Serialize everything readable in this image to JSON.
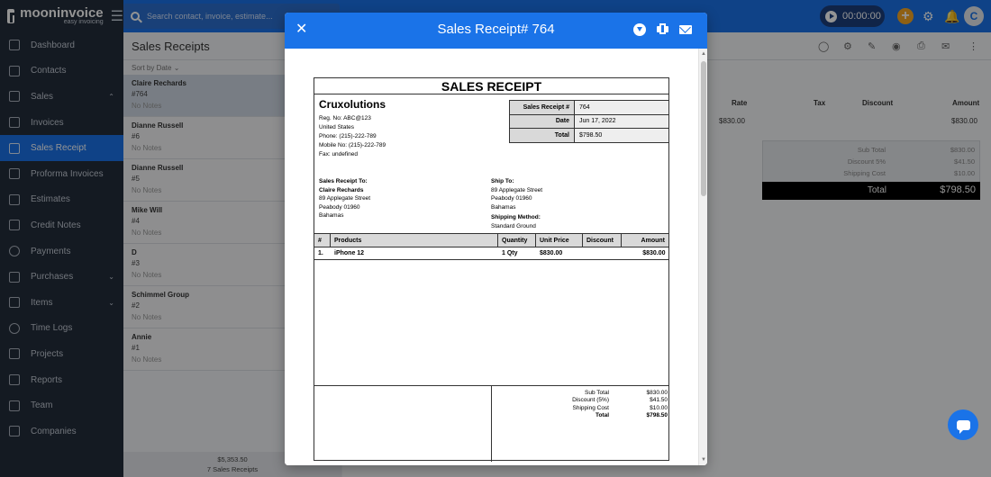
{
  "app": {
    "brand": "mooninvoice",
    "tagline": "easy invoicing",
    "search_placeholder": "Search contact, invoice, estimate...",
    "timer": "00:00:00",
    "avatar_letter": "C",
    "accent": "#1a73e8"
  },
  "sidebar": {
    "items": [
      {
        "label": "Dashboard",
        "icon": "home-icon"
      },
      {
        "label": "Contacts",
        "icon": "contacts-icon"
      },
      {
        "label": "Sales",
        "icon": "dollar-doc-icon",
        "chevron": "^"
      },
      {
        "label": "Invoices",
        "icon": "invoice-icon"
      },
      {
        "label": "Sales Receipt",
        "icon": "receipt-icon"
      },
      {
        "label": "Proforma Invoices",
        "icon": "proforma-icon"
      },
      {
        "label": "Estimates",
        "icon": "estimate-icon"
      },
      {
        "label": "Credit Notes",
        "icon": "credit-note-icon"
      },
      {
        "label": "Payments",
        "icon": "payment-icon"
      },
      {
        "label": "Purchases",
        "icon": "purchase-icon",
        "chevron": "v"
      },
      {
        "label": "Items",
        "icon": "items-icon",
        "chevron": "v"
      },
      {
        "label": "Time Logs",
        "icon": "clock-icon"
      },
      {
        "label": "Projects",
        "icon": "folder-icon"
      },
      {
        "label": "Reports",
        "icon": "report-icon"
      },
      {
        "label": "Team",
        "icon": "team-icon"
      },
      {
        "label": "Companies",
        "icon": "building-icon"
      }
    ]
  },
  "list": {
    "title": "Sales Receipts",
    "sort": "Sort by Date",
    "receipts": [
      {
        "name": "Claire Rechards",
        "number": "#764",
        "notes": "No Notes"
      },
      {
        "name": "Dianne Russell",
        "number": "#6",
        "notes": "No Notes"
      },
      {
        "name": "Dianne Russell",
        "number": "#5",
        "notes": "No Notes"
      },
      {
        "name": "Mike Will",
        "number": "#4",
        "notes": "No Notes"
      },
      {
        "name": "D",
        "number": "#3",
        "notes": "No Notes"
      },
      {
        "name": "Schimmel Group",
        "number": "#2",
        "notes": "No Notes"
      },
      {
        "name": "Annie",
        "number": "#1",
        "notes": "No Notes"
      }
    ],
    "footer_total": "$5,353.50",
    "footer_count": "7 Sales Receipts"
  },
  "detail": {
    "columns": [
      "Rate",
      "Tax",
      "Discount",
      "Amount"
    ],
    "row": {
      "rate": "$830.00",
      "amount": "$830.00"
    },
    "summary": {
      "sub_total_label": "Sub Total",
      "sub_total": "$830.00",
      "discount_label": "Discount 5%",
      "discount": "$41.50",
      "shipping_label": "Shipping Cost",
      "shipping": "$10.00",
      "total_label": "Total",
      "total": "$798.50"
    }
  },
  "modal": {
    "title": "Sales Receipt# 764",
    "doc": {
      "heading": "SALES RECEIPT",
      "company": "Cruxolutions",
      "company_lines": [
        "Reg. No: ABC@123",
        "United States",
        "Phone: (215)-222-789",
        "Mobile No: (215)-222-789",
        "Fax: undefined"
      ],
      "meta": [
        {
          "label": "Sales Receipt #",
          "value": "764"
        },
        {
          "label": "Date",
          "value": "Jun 17, 2022"
        },
        {
          "label": "Total",
          "value": "$798.50"
        }
      ],
      "bill_to_label": "Sales Receipt To:",
      "bill_to_name": "Claire Rechards",
      "bill_to_lines": [
        "89 Applegate Street",
        "Peabody  01960",
        "Bahamas"
      ],
      "ship_to_label": "Ship To:",
      "ship_to_lines": [
        "89 Applegate Street",
        "Peabody  01960",
        "Bahamas"
      ],
      "shipping_method_label": "Shipping Method:",
      "shipping_method": "Standard Ground",
      "item_headers": [
        "#",
        "Products",
        "Quantity",
        "Unit Price",
        "Discount",
        "Amount"
      ],
      "items": [
        {
          "num": "1.",
          "product": "iPhone 12",
          "qty": "1 Qty",
          "unit_price": "$830.00",
          "discount": "",
          "amount": "$830.00"
        }
      ],
      "totals": [
        {
          "label": "Sub Total",
          "value": "$830.00"
        },
        {
          "label": "Discount (5%)",
          "value": "$41.50"
        },
        {
          "label": "Shipping Cost",
          "value": "$10.00"
        },
        {
          "label": "Total",
          "value": "$798.50"
        }
      ]
    }
  }
}
